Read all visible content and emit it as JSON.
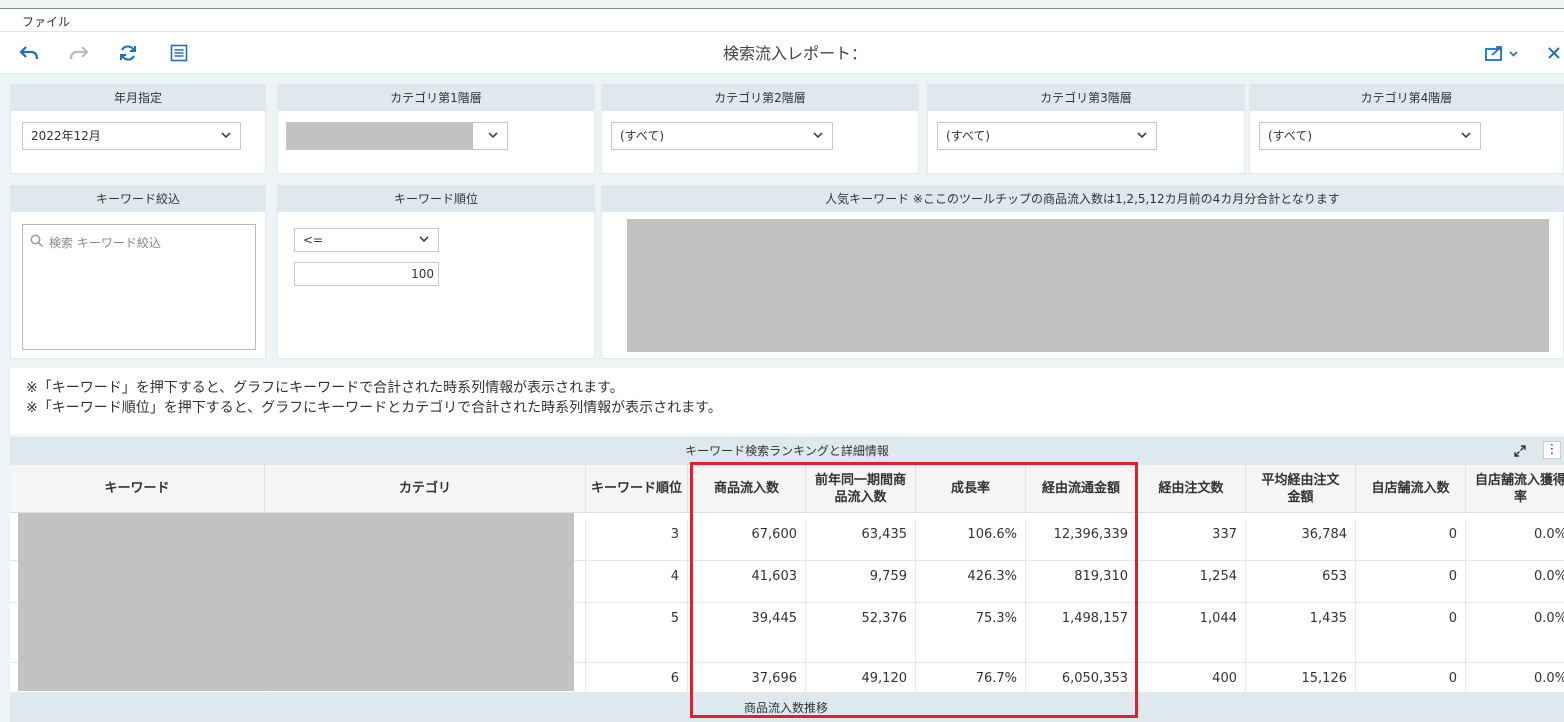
{
  "menu": {
    "file": "ファイル"
  },
  "toolbar": {
    "title": "検索流入レポート：",
    "icons": [
      "undo-icon",
      "redo-icon",
      "refresh-icon",
      "list-icon",
      "share-icon",
      "close-icon"
    ]
  },
  "filters": {
    "year_month": {
      "label": "年月指定",
      "value": "2022年12月"
    },
    "cat1": {
      "label": "カテゴリ第1階層",
      "value": ""
    },
    "cat2": {
      "label": "カテゴリ第2階層",
      "value": "(すべて)"
    },
    "cat3": {
      "label": "カテゴリ第3階層",
      "value": "(すべて)"
    },
    "cat4": {
      "label": "カテゴリ第4階層",
      "value": "(すべて)"
    }
  },
  "keyword_filter": {
    "label": "キーワード絞込",
    "placeholder": "検索 キーワード絞込"
  },
  "keyword_rank": {
    "label": "キーワード順位",
    "operator": "<=",
    "value": "100"
  },
  "popular": {
    "label": "人気キーワード ※ここのツールチップの商品流入数は1,2,5,12カ月前の4カ月分合計となります"
  },
  "notes": [
    "※「キーワード」を押下すると、グラフにキーワードで合計された時系列情報が表示されます。",
    "※「キーワード順位」を押下すると、グラフにキーワードとカテゴリで合計された時系列情報が表示されます。"
  ],
  "table": {
    "title": "キーワード検索ランキングと詳細情報",
    "columns": [
      "キーワード",
      "カテゴリ",
      "キーワード順位",
      "商品流入数",
      "前年同一期間商品流入数",
      "成長率",
      "経由流通金額",
      "経由注文数",
      "平均経由注文金額",
      "自店舗流入数",
      "自店舗流入獲得率"
    ],
    "rows": [
      [
        "",
        "",
        "3",
        "67,600",
        "63,435",
        "106.6%",
        "12,396,339",
        "337",
        "36,784",
        "0",
        "0.0%"
      ],
      [
        "",
        "",
        "4",
        "41,603",
        "9,759",
        "426.3%",
        "819,310",
        "1,254",
        "653",
        "0",
        "0.0%"
      ],
      [
        "",
        "",
        "5",
        "39,445",
        "52,376",
        "75.3%",
        "1,498,157",
        "1,044",
        "1,435",
        "0",
        "0.0%"
      ],
      [
        "",
        "",
        "6",
        "37,696",
        "49,120",
        "76.7%",
        "6,050,353",
        "400",
        "15,126",
        "0",
        "0.0%"
      ]
    ],
    "footer": "商品流入数推移"
  }
}
